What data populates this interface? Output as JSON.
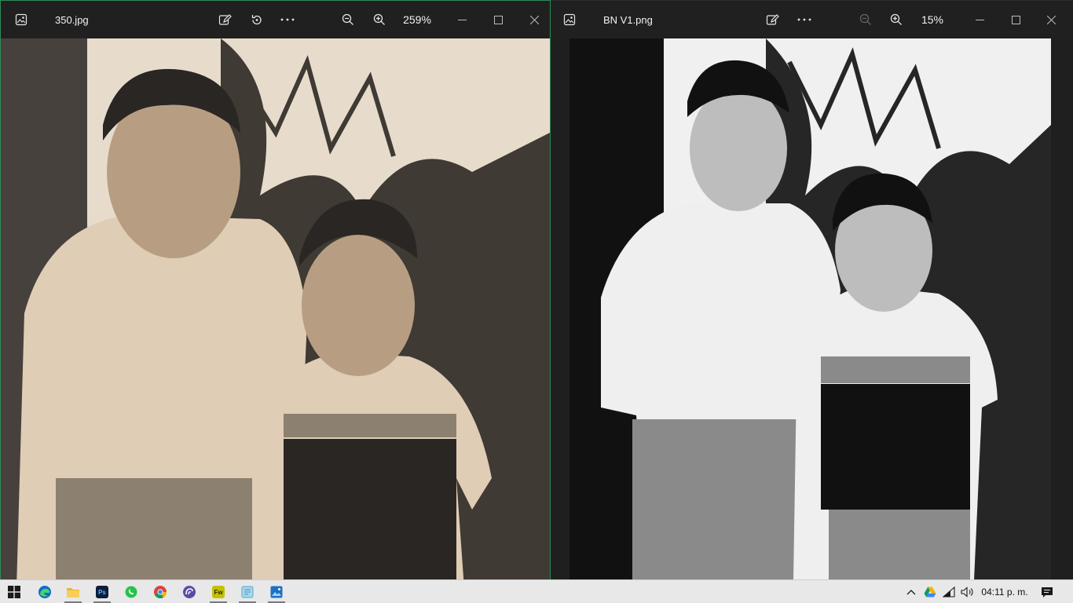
{
  "windows": [
    {
      "file_name": "350.jpg",
      "zoom": "259%",
      "photo": {
        "tone": "sepia",
        "colors": {
          "sky": "#e7dccc",
          "foliage": "#3f3a33",
          "shirt": "#e0cdb6",
          "skin": "#b79e82",
          "dark": "#2a2623",
          "pants": "#8c8070"
        }
      }
    },
    {
      "file_name": "BN V1.png",
      "zoom": "15%",
      "photo": {
        "tone": "black-and-white",
        "colors": {
          "sky": "#f0f0f0",
          "foliage": "#262626",
          "shirt": "#efefef",
          "skin": "#bdbdbd",
          "dark": "#111111",
          "pants": "#8a8a8a"
        }
      }
    }
  ],
  "icons": {
    "image": "image-icon",
    "edit": "edit-image-icon",
    "rotate": "rotate-icon",
    "more": "more-options-icon",
    "zoom_out": "zoom-out-icon",
    "zoom_in": "zoom-in-icon",
    "minimize": "minimize-icon",
    "maximize": "maximize-icon",
    "close": "close-icon"
  },
  "taskbar": {
    "apps": [
      "windows-start",
      "edge",
      "file-explorer",
      "photoshop",
      "whatsapp",
      "chrome",
      "arc-browser",
      "fireworks",
      "notes",
      "photos"
    ],
    "app_labels": {
      "photoshop": "Ps",
      "fireworks": "Fw"
    },
    "clock": "04:11 p. m.",
    "colors": {
      "accent_window_border": "#2e8b57"
    }
  }
}
